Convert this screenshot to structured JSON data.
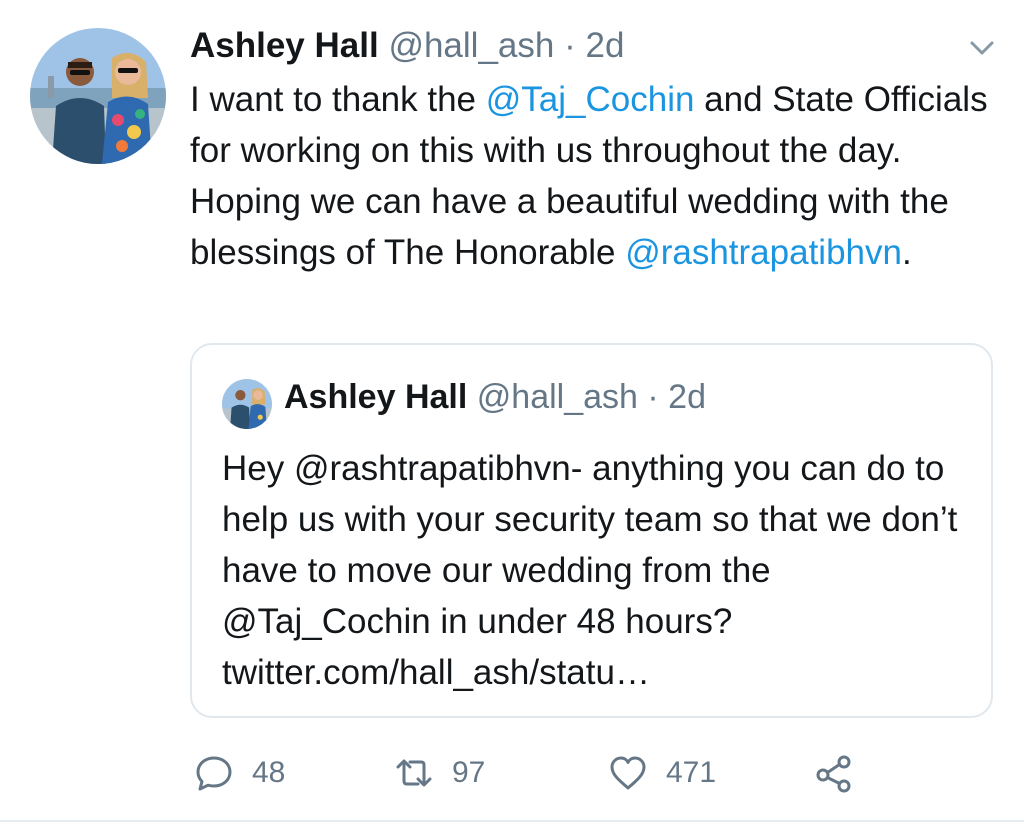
{
  "tweet": {
    "author": {
      "name": "Ashley Hall",
      "handle": "@hall_ash",
      "separator": "·",
      "time": "2d"
    },
    "text": {
      "part1": "I want to thank the ",
      "mention1": "@Taj_Cochin",
      "part2": " and State Officials for working on this with us throughout the day. Hoping we can have a beautiful wedding with the blessings of The Honorable ",
      "mention2": "@rashtrapatibhvn",
      "part3": "."
    },
    "quoted": {
      "author": {
        "name": "Ashley Hall",
        "handle": "@hall_ash",
        "separator": "·",
        "time": "2d"
      },
      "text": "Hey @rashtrapatibhvn- anything you can do to help us with your security team so that we don’t have to move our wedding from the @Taj_Cochin in under 48 hours? twitter.com/hall_ash/statu…"
    },
    "actions": {
      "replies": "48",
      "retweets": "97",
      "likes": "471"
    }
  },
  "colors": {
    "text": "#14171a",
    "secondary": "#657786",
    "link": "#1b95e0",
    "border": "#e1e8ed"
  },
  "icons": [
    "chevron-down-icon",
    "reply-icon",
    "retweet-icon",
    "heart-icon",
    "share-icon"
  ]
}
